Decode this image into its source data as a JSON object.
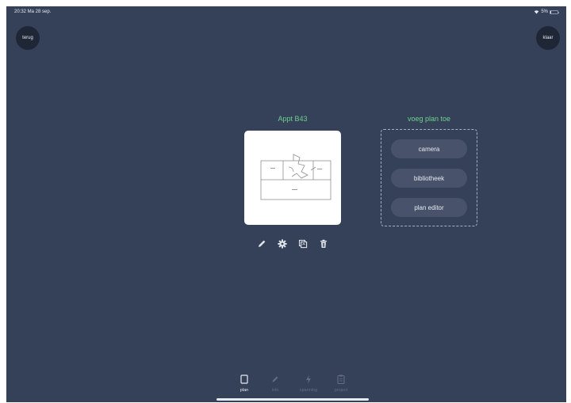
{
  "status_bar": {
    "time_date": "20:32  Ma 28 sep.",
    "battery": "5%",
    "battery_level": 0.05
  },
  "nav": {
    "back_label": "terug",
    "done_label": "klaar"
  },
  "plan": {
    "title": "Appt B43"
  },
  "add_plan": {
    "title": "voeg plan toe",
    "options": [
      "camera",
      "bibliotheek",
      "plan editor"
    ]
  },
  "tabs": [
    {
      "label": "plan",
      "active": true,
      "icon": "document-icon"
    },
    {
      "label": "info",
      "active": false,
      "icon": "pencil-icon"
    },
    {
      "label": "spanning",
      "active": false,
      "icon": "lightning-icon"
    },
    {
      "label": "project",
      "active": false,
      "icon": "clipboard-icon"
    }
  ],
  "colors": {
    "background": "#354158",
    "accent_green": "#6fcf8f",
    "button_dark": "#1f2736",
    "option_bg": "#48536b"
  }
}
